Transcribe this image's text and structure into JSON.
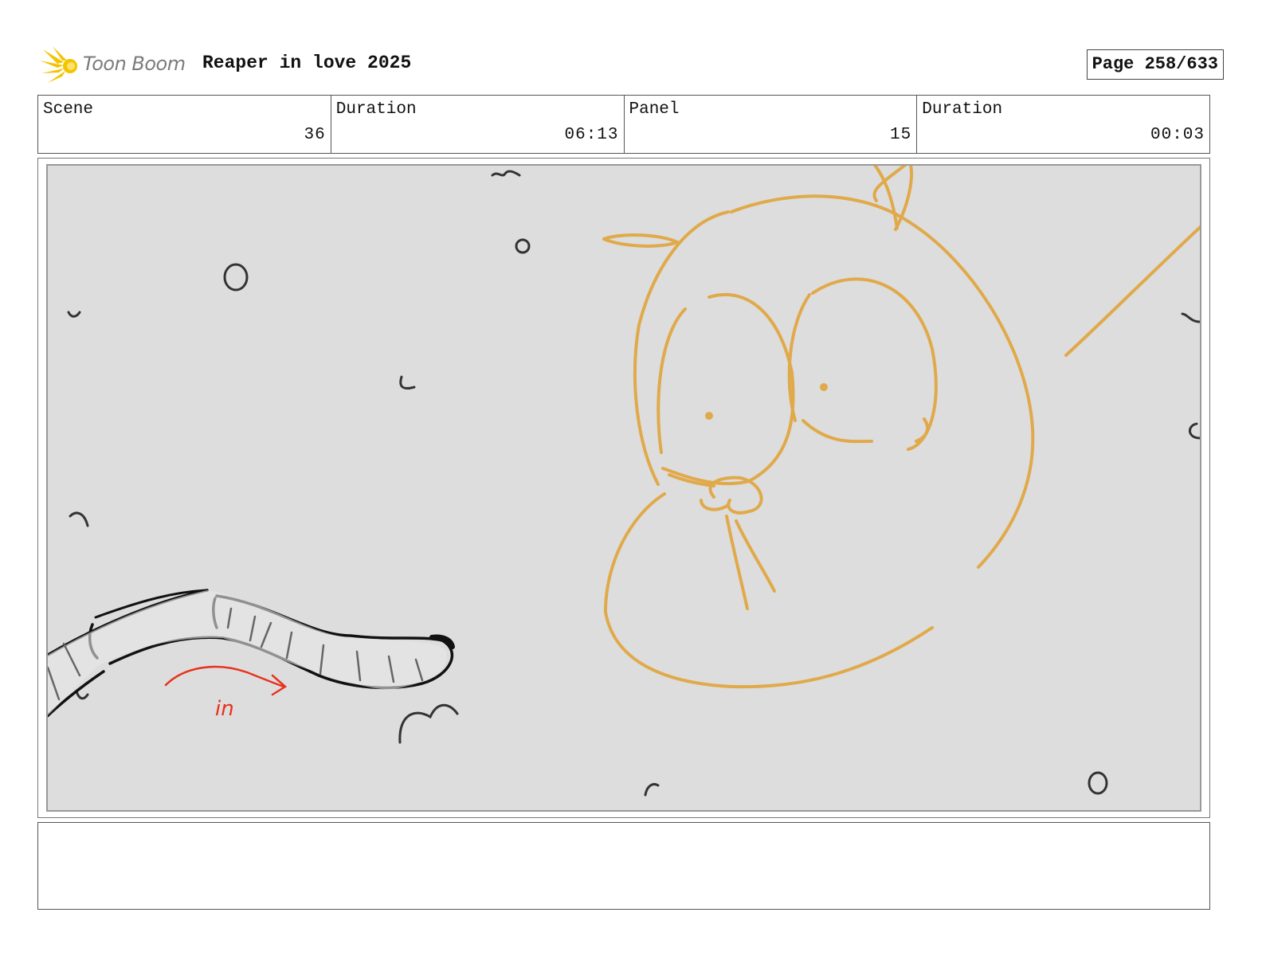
{
  "header": {
    "logo_text": "Toon Boom",
    "project_title": "Reaper in love 2025",
    "page_indicator": "Page 258/633"
  },
  "info": {
    "scene_label": "Scene",
    "scene_value": "36",
    "scene_duration_label": "Duration",
    "scene_duration_value": "06:13",
    "panel_label": "Panel",
    "panel_value": "15",
    "panel_duration_label": "Duration",
    "panel_duration_value": "00:03"
  },
  "panel": {
    "annotation": "in",
    "colors": {
      "background": "#dddddd",
      "character": "#e0a94a",
      "ink": "#111111",
      "annotation": "#e8321e"
    }
  },
  "notes": {
    "text": ""
  }
}
